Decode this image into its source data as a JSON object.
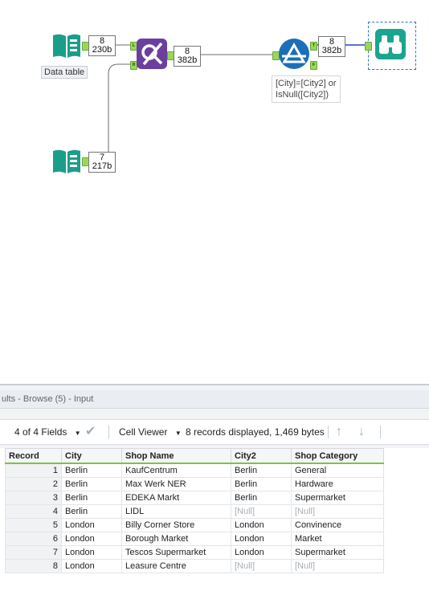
{
  "canvas": {
    "input1": {
      "count_records": "8",
      "count_bytes": "230b",
      "annotation": "Data table"
    },
    "input2": {
      "count_records": "7",
      "count_bytes": "217b"
    },
    "join": {
      "count_records": "8",
      "count_bytes": "382b",
      "anchor_left": "L",
      "anchor_right": "R"
    },
    "filter": {
      "count_records": "8",
      "count_bytes": "382b",
      "annotation_line1": "[City]=[City2] or",
      "annotation_line2": "IsNull([City2])",
      "anchor_true": "T",
      "anchor_false": "F"
    },
    "browse": {},
    "colors": {
      "input_tool": "#1a9e8a",
      "join_tool": "#6b3fa0",
      "filter_tool": "#1b6fb8",
      "browse_tool": "#1aa58f",
      "wire": "#6b6b6b",
      "selected_wire": "#2244cc",
      "anchor": "#9bd65a"
    }
  },
  "results": {
    "title": "ults - Browse (5) - Input",
    "toolbar": {
      "fields_label": "4 of 4 Fields",
      "viewer_label": "Cell Viewer",
      "records_info": "8 records displayed, 1,469 bytes"
    },
    "columns": [
      "Record",
      "City",
      "Shop Name",
      "City2",
      "Shop Category"
    ],
    "rows": [
      {
        "record": "1",
        "city": "Berlin",
        "shop": "KaufCentrum",
        "city2": "Berlin",
        "category": "General"
      },
      {
        "record": "2",
        "city": "Berlin",
        "shop": "Max Werk NER",
        "city2": "Berlin",
        "category": "Hardware"
      },
      {
        "record": "3",
        "city": "Berlin",
        "shop": "EDEKA Markt",
        "city2": "Berlin",
        "category": "Supermarket"
      },
      {
        "record": "4",
        "city": "Berlin",
        "shop": "LIDL",
        "city2": "[Null]",
        "category": "[Null]"
      },
      {
        "record": "5",
        "city": "London",
        "shop": "Billy Corner Store",
        "city2": "London",
        "category": "Convinence"
      },
      {
        "record": "6",
        "city": "London",
        "shop": "Borough Market",
        "city2": "London",
        "category": "Market"
      },
      {
        "record": "7",
        "city": "London",
        "shop": "Tescos Supermarket",
        "city2": "London",
        "category": "Supermarket"
      },
      {
        "record": "8",
        "city": "London",
        "shop": "Leasure Centre",
        "city2": "[Null]",
        "category": "[Null]"
      }
    ]
  }
}
